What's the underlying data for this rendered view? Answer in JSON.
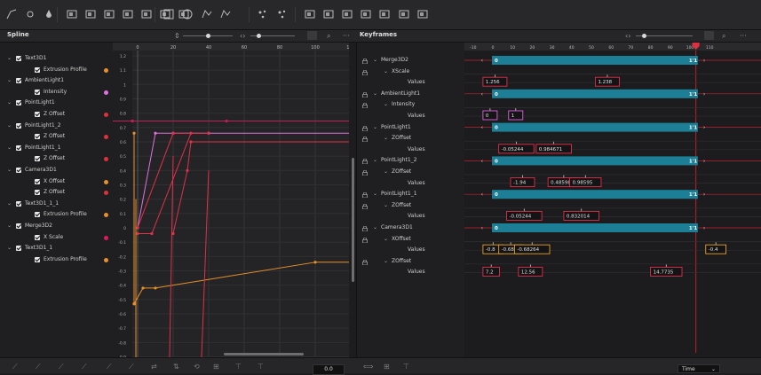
{
  "spline": {
    "title": "Spline",
    "ruler_ticks": [
      "0",
      "20",
      "40",
      "60",
      "80",
      "100",
      "120"
    ],
    "y_ticks": [
      "1.2",
      "1.1",
      "1",
      "0.9",
      "0.8",
      "0.7",
      "0.6",
      "0.5",
      "0.4",
      "0.3",
      "0.2",
      "0.1",
      "0",
      "-0.1",
      "-0.2",
      "-0.3",
      "-0.4",
      "-0.5",
      "-0.6",
      "-0.7",
      "-0.8",
      "-0.9",
      "-1"
    ],
    "tree": [
      {
        "label": "Text3D1",
        "level": 0,
        "dot": null
      },
      {
        "label": "Extrusion Profile",
        "level": 1,
        "dot": "#e8902a"
      },
      {
        "label": "AmbientLight1",
        "level": 0,
        "dot": null
      },
      {
        "label": "Intensity",
        "level": 1,
        "dot": "#e070e0"
      },
      {
        "label": "PointLight1",
        "level": 0,
        "dot": null
      },
      {
        "label": "Z Offset",
        "level": 1,
        "dot": "#e0303a"
      },
      {
        "label": "PointLight1_2",
        "level": 0,
        "dot": null
      },
      {
        "label": "Z Offset",
        "level": 1,
        "dot": "#e0303a"
      },
      {
        "label": "PointLight1_1",
        "level": 0,
        "dot": null
      },
      {
        "label": "Z Offset",
        "level": 1,
        "dot": "#e0303a"
      },
      {
        "label": "Camera3D1",
        "level": 0,
        "dot": null
      },
      {
        "label": "X Offset",
        "level": 1,
        "dot": "#e8902a"
      },
      {
        "label": "Z Offset",
        "level": 1,
        "dot": "#e0303a"
      },
      {
        "label": "Text3D1_1_1",
        "level": 0,
        "dot": null
      },
      {
        "label": "Extrusion Profile",
        "level": 1,
        "dot": "#e8902a"
      },
      {
        "label": "Merge3D2",
        "level": 0,
        "dot": null
      },
      {
        "label": "X Scale",
        "level": 1,
        "dot": "#e01860"
      },
      {
        "label": "Text3D1_1",
        "level": 0,
        "dot": null
      },
      {
        "label": "Extrusion Profile",
        "level": 1,
        "dot": "#e8902a"
      }
    ],
    "bottom_value": "0.0"
  },
  "keyframes": {
    "title": "Keyframes",
    "ruler_ticks": [
      "-10",
      "0",
      "10",
      "20",
      "30",
      "40",
      "50",
      "60",
      "70",
      "80",
      "90",
      "100",
      "110"
    ],
    "rows": [
      {
        "label": "Merge3D2",
        "level": 0,
        "type": "bar",
        "start": "0",
        "end": "1'1"
      },
      {
        "label": "XScale",
        "level": 1,
        "type": "none"
      },
      {
        "label": "Values",
        "level": 2,
        "type": "values",
        "color": "#e0304a",
        "values": [
          "1.256",
          "1.238"
        ]
      },
      {
        "label": "AmbientLight1",
        "level": 0,
        "type": "bar",
        "start": "0",
        "end": "1'1"
      },
      {
        "label": "Intensity",
        "level": 1,
        "type": "none"
      },
      {
        "label": "Values",
        "level": 2,
        "type": "values",
        "color": "#e060e0",
        "values": [
          "0",
          "1"
        ]
      },
      {
        "label": "PointLight1",
        "level": 0,
        "type": "bar",
        "start": "0",
        "end": "1'1"
      },
      {
        "label": "ZOffset",
        "level": 1,
        "type": "none"
      },
      {
        "label": "Values",
        "level": 2,
        "type": "values",
        "color": "#e0304a",
        "values": [
          "-0.05244",
          "0.984671"
        ]
      },
      {
        "label": "PointLight1_2",
        "level": 0,
        "type": "bar",
        "start": "0",
        "end": "1'1"
      },
      {
        "label": "ZOffset",
        "level": 1,
        "type": "none"
      },
      {
        "label": "Values",
        "level": 2,
        "type": "values",
        "color": "#e0304a",
        "values": [
          "-1.94",
          "0.48598",
          "0.98595"
        ]
      },
      {
        "label": "PointLight1_1",
        "level": 0,
        "type": "bar",
        "start": "0",
        "end": "1'1"
      },
      {
        "label": "ZOffset",
        "level": 1,
        "type": "none"
      },
      {
        "label": "Values",
        "level": 2,
        "type": "values",
        "color": "#e0304a",
        "values": [
          "-0.05244",
          "0.832014"
        ]
      },
      {
        "label": "Camera3D1",
        "level": 0,
        "type": "bar",
        "start": "0",
        "end": "1'1"
      },
      {
        "label": "XOffset",
        "level": 1,
        "type": "none"
      },
      {
        "label": "Values",
        "level": 2,
        "type": "values",
        "color": "#e8a020",
        "values": [
          "-0.8",
          "-0.68",
          "-0.68264",
          "-0.4"
        ]
      },
      {
        "label": "ZOffset",
        "level": 1,
        "type": "none"
      },
      {
        "label": "Values",
        "level": 2,
        "type": "values",
        "color": "#e0304a",
        "values": [
          "7.2",
          "12.56",
          "14.7735"
        ]
      }
    ],
    "time_label": "Time"
  },
  "toolbar": {
    "icons": [
      "spline-tool-icon",
      "sun-icon",
      "drop-icon",
      "image-icon",
      "image-icon",
      "image-icon",
      "image-icon",
      "image-icon",
      "image-icon",
      "image-icon",
      "rect-select-icon",
      "circle-select-icon",
      "polygon-icon",
      "bspline-icon",
      "particle-icon",
      "particle-icon",
      "cube-icon",
      "cubes-icon",
      "text3d-icon",
      "box-icon",
      "camera-icon",
      "light-icon",
      "sphere-icon"
    ]
  },
  "colors": {
    "accent_teal": "#1c7f95",
    "red_curve": "#e0304a",
    "pink_curve": "#e070e0",
    "orange_curve": "#e8902a",
    "crimson_curve": "#c0205a"
  }
}
